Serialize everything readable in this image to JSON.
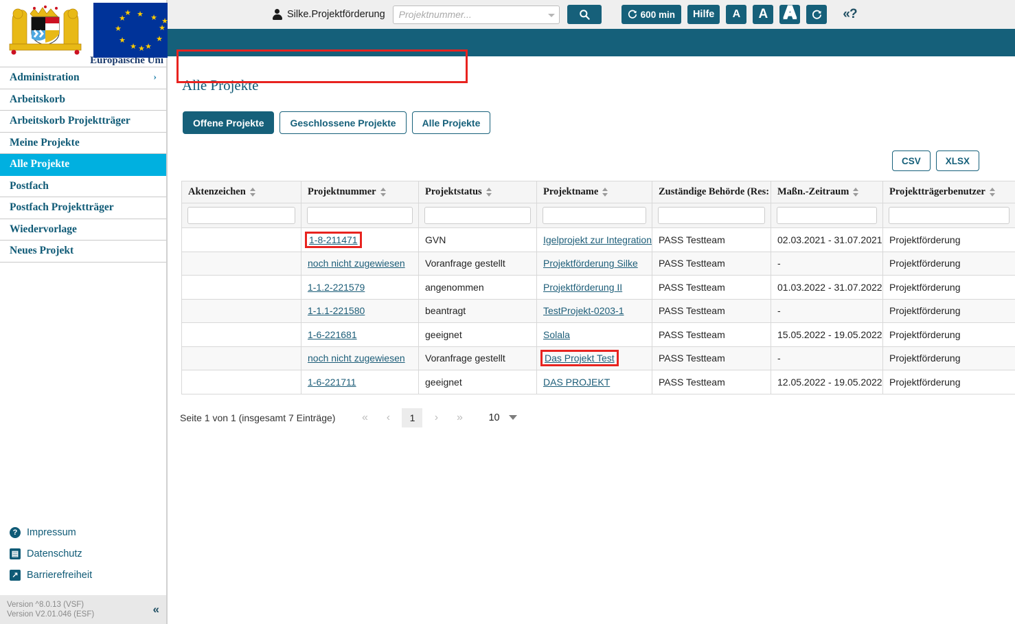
{
  "brand": {
    "eu_caption": "Europäische Uni",
    "colors": {
      "teal": "#16607a",
      "cyan": "#00b0e0",
      "annotation_red": "#e8231f",
      "eu_blue": "#003399"
    }
  },
  "header": {
    "user_name": "Silke.Projektförderung",
    "search_placeholder": "Projektnummer...",
    "search_value": "",
    "search_button_icon": "search-icon",
    "timer_label": "600 min",
    "timer_icon": "refresh-icon",
    "help_label": "Hilfe",
    "font_small_label": "A",
    "font_medium_label": "A",
    "font_large_label": "A",
    "refresh_icon": "refresh-icon",
    "help_toggle_label": "«?"
  },
  "sidebar": {
    "items": [
      {
        "label": "Administration",
        "active": false,
        "chevron": "›"
      },
      {
        "label": "Arbeitskorb",
        "active": false
      },
      {
        "label": "Arbeitskorb Projektträger",
        "active": false
      },
      {
        "label": "Meine Projekte",
        "active": false
      },
      {
        "label": "Alle Projekte",
        "active": true
      },
      {
        "label": "Postfach",
        "active": false
      },
      {
        "label": "Postfach Projektträger",
        "active": false
      },
      {
        "label": "Wiedervorlage",
        "active": false
      },
      {
        "label": "Neues Projekt",
        "active": false
      }
    ],
    "footer_links": [
      {
        "label": "Impressum",
        "icon": "question-mark-icon",
        "glyph": "?"
      },
      {
        "label": "Datenschutz",
        "icon": "document-icon",
        "glyph": "▤"
      },
      {
        "label": "Barrierefreiheit",
        "icon": "arrow-up-right-icon",
        "glyph": "↗"
      }
    ],
    "version_line_1": "Version ^8.0.13 (VSF)",
    "version_line_2": "Version V2.01.046 (ESF)",
    "collapse_label": "«"
  },
  "main": {
    "page_title": "Alle Projekte",
    "tabs": [
      {
        "label": "Offene Projekte",
        "active": true
      },
      {
        "label": "Geschlossene Projekte",
        "active": false
      },
      {
        "label": "Alle Projekte",
        "active": false
      }
    ],
    "export_buttons": [
      {
        "label": "CSV"
      },
      {
        "label": "XLSX"
      }
    ],
    "table": {
      "columns": [
        {
          "label": "Aktenzeichen",
          "sortable": true
        },
        {
          "label": "Projektnummer",
          "sortable": true
        },
        {
          "label": "Projektstatus",
          "sortable": true
        },
        {
          "label": "Projektname",
          "sortable": true
        },
        {
          "label": "Zuständige Behörde (Res:",
          "sortable": true
        },
        {
          "label": "Maßn.-Zeitraum",
          "sortable": true
        },
        {
          "label": "Projektträgerbenutzer",
          "sortable": true
        }
      ],
      "filters": [
        "",
        "",
        "",
        "",
        "",
        "",
        ""
      ],
      "rows": [
        {
          "aktenzeichen": "",
          "projektnummer": "1-8-211471",
          "projektnummer_link": true,
          "projektnummer_highlighted": true,
          "projektstatus": "GVN",
          "projektname": "Igelprojekt zur Integrations",
          "projektname_link": true,
          "projektname_highlighted": false,
          "behoerde": "PASS Testteam",
          "zeitraum": "02.03.2021 - 31.07.2021",
          "benutzer": "Projektförderung"
        },
        {
          "aktenzeichen": "",
          "projektnummer": "noch nicht zugewiesen",
          "projektnummer_link": true,
          "projektnummer_highlighted": false,
          "projektstatus": "Voranfrage gestellt",
          "projektname": "Projektförderung Silke",
          "projektname_link": true,
          "projektname_highlighted": false,
          "behoerde": "PASS Testteam",
          "zeitraum": "-",
          "benutzer": "Projektförderung"
        },
        {
          "aktenzeichen": "",
          "projektnummer": "1-1.2-221579",
          "projektnummer_link": true,
          "projektnummer_highlighted": false,
          "projektstatus": "angenommen",
          "projektname": "Projektförderung II",
          "projektname_link": true,
          "projektname_highlighted": false,
          "behoerde": "PASS Testteam",
          "zeitraum": "01.03.2022 - 31.07.2022",
          "benutzer": "Projektförderung"
        },
        {
          "aktenzeichen": "",
          "projektnummer": "1-1.1-221580",
          "projektnummer_link": true,
          "projektnummer_highlighted": false,
          "projektstatus": "beantragt",
          "projektname": "TestProjekt-0203-1",
          "projektname_link": true,
          "projektname_highlighted": false,
          "behoerde": "PASS Testteam",
          "zeitraum": "-",
          "benutzer": "Projektförderung"
        },
        {
          "aktenzeichen": "",
          "projektnummer": "1-6-221681",
          "projektnummer_link": true,
          "projektnummer_highlighted": false,
          "projektstatus": "geeignet",
          "projektname": "Solala",
          "projektname_link": true,
          "projektname_highlighted": false,
          "behoerde": "PASS Testteam",
          "zeitraum": "15.05.2022 - 19.05.2022",
          "benutzer": "Projektförderung"
        },
        {
          "aktenzeichen": "",
          "projektnummer": "noch nicht zugewiesen",
          "projektnummer_link": true,
          "projektnummer_highlighted": false,
          "projektstatus": "Voranfrage gestellt",
          "projektname": "Das Projekt Test",
          "projektname_link": true,
          "projektname_highlighted": true,
          "behoerde": "PASS Testteam",
          "zeitraum": "-",
          "benutzer": "Projektförderung"
        },
        {
          "aktenzeichen": "",
          "projektnummer": "1-6-221711",
          "projektnummer_link": true,
          "projektnummer_highlighted": false,
          "projektstatus": "geeignet",
          "projektname": "DAS PROJEKT",
          "projektname_link": true,
          "projektname_highlighted": false,
          "behoerde": "PASS Testteam",
          "zeitraum": "12.05.2022 - 19.05.2022",
          "benutzer": "Projektförderung"
        }
      ]
    },
    "pagination": {
      "info": "Seite 1 von 1 (insgesamt 7 Einträge)",
      "first_label": "«",
      "prev_label": "‹",
      "current_page": "1",
      "next_label": "›",
      "last_label": "»",
      "page_size": "10"
    }
  }
}
